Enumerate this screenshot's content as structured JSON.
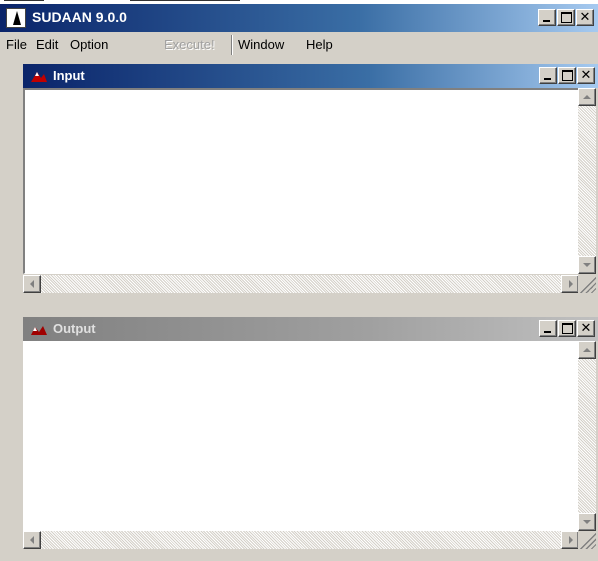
{
  "app": {
    "title": "SUDAAN 9.0.0"
  },
  "menu": {
    "file": "File",
    "edit": "Edit",
    "option": "Option",
    "execute": "Execute!",
    "window": "Window",
    "help": "Help"
  },
  "windows": {
    "input": {
      "title": "Input",
      "state": "active"
    },
    "output": {
      "title": "Output",
      "state": "inactive"
    }
  },
  "colors": {
    "active_title_start": "#0a246a",
    "active_title_end": "#a6caf0",
    "inactive_title_start": "#808080",
    "face": "#d4d0c8",
    "disabled_text": "#a0a0a0"
  },
  "icons": {
    "app": "sudaan-logo-icon",
    "input_window": "input-doc-icon",
    "output_window": "output-doc-icon",
    "minimize": "minimize-icon",
    "maximize": "maximize-icon",
    "close": "close-icon"
  }
}
